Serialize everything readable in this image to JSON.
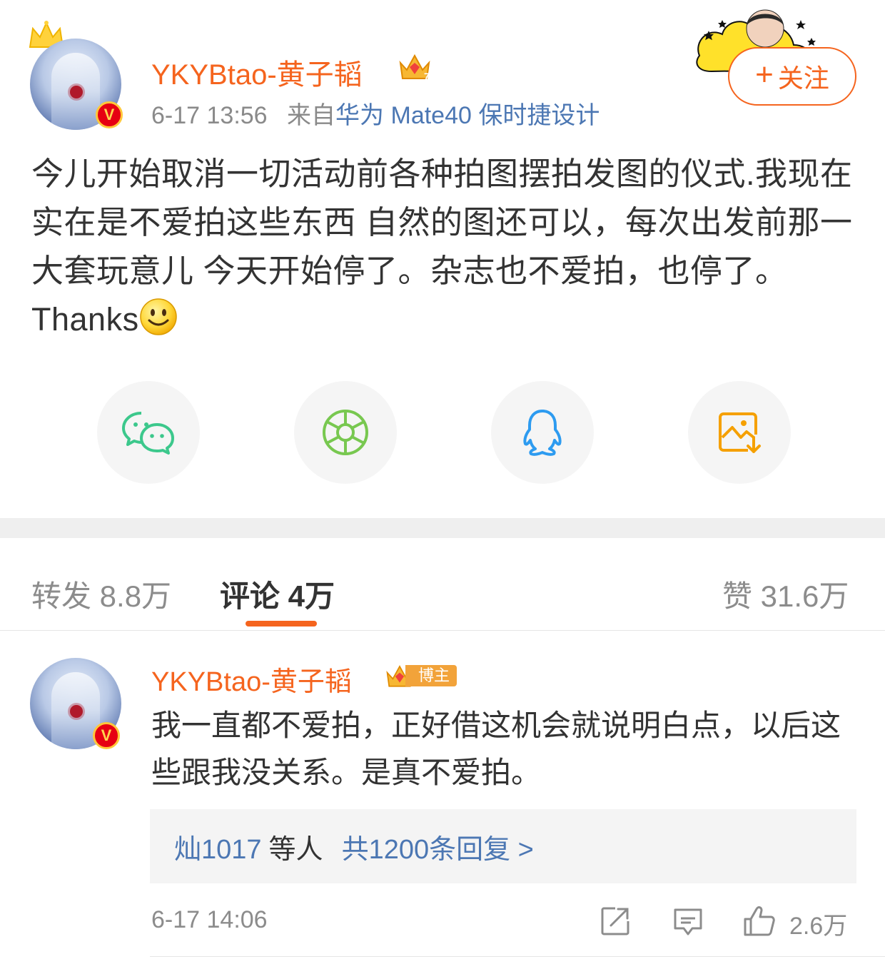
{
  "post": {
    "author": "YKYBtao-黄子韬",
    "time": "6-17 13:56",
    "source_prefix": "来自",
    "source": "华为 Mate40 保时捷设计",
    "text": "今儿开始取消一切活动前各种拍图摆拍发图的仪式.我现在实在是不爱拍这些东西 自然的图还可以，每次出发前那一大套玩意儿 今天开始停了。杂志也不爱拍，也停了。Thanks",
    "follow_label": "关注",
    "verified_badge": "V"
  },
  "share": [
    {
      "icon": "wechat-icon"
    },
    {
      "icon": "moments-icon"
    },
    {
      "icon": "qq-icon"
    },
    {
      "icon": "save-image-icon"
    }
  ],
  "tabs": {
    "repost": "转发 8.8万",
    "comments": "评论 4万",
    "likes": "赞 31.6万"
  },
  "comment": {
    "author": "YKYBtao-黄子韬",
    "badge": "博主",
    "text": "我一直都不爱拍，正好借这机会就说明白点，以后这些跟我没关系。是真不爱拍。",
    "reply_user": "灿1017",
    "reply_others": "等人",
    "reply_count": "共1200条回复 >",
    "time": "6-17 14:06",
    "likes": "2.6万"
  },
  "colors": {
    "accent": "#f5641e",
    "link": "#4c77b3",
    "wechat": "#3cc88c",
    "moments": "#78c850",
    "qq": "#2d9bf0",
    "save": "#f5a000"
  }
}
